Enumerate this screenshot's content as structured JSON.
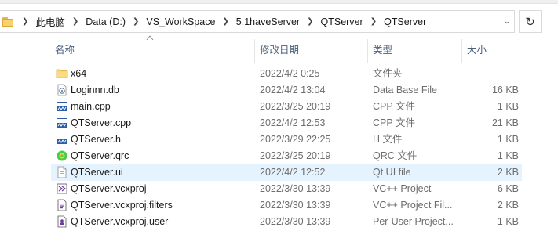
{
  "breadcrumb": [
    "此电脑",
    "Data (D:)",
    "VS_WorkSpace",
    "5.1haveServer",
    "QTServer",
    "QTServer"
  ],
  "columns": {
    "name": "名称",
    "date": "修改日期",
    "type": "类型",
    "size": "大小"
  },
  "files": [
    {
      "name": "x64",
      "date": "2022/4/2 0:25",
      "type": "文件夹",
      "size": "",
      "icon": "folder-icon"
    },
    {
      "name": "Loginnn.db",
      "date": "2022/4/2 13:04",
      "type": "Data Base File",
      "size": "16 KB",
      "icon": "database-file-icon"
    },
    {
      "name": "main.cpp",
      "date": "2022/3/25 20:19",
      "type": "CPP 文件",
      "size": "1 KB",
      "icon": "cpp-file-icon"
    },
    {
      "name": "QTServer.cpp",
      "date": "2022/4/2 12:53",
      "type": "CPP 文件",
      "size": "21 KB",
      "icon": "cpp-file-icon"
    },
    {
      "name": "QTServer.h",
      "date": "2022/3/29 22:25",
      "type": "H 文件",
      "size": "1 KB",
      "icon": "header-file-icon"
    },
    {
      "name": "QTServer.qrc",
      "date": "2022/3/25 20:19",
      "type": "QRC 文件",
      "size": "1 KB",
      "icon": "qt-resource-icon"
    },
    {
      "name": "QTServer.ui",
      "date": "2022/4/2 12:52",
      "type": "Qt UI file",
      "size": "2 KB",
      "icon": "ui-file-icon"
    },
    {
      "name": "QTServer.vcxproj",
      "date": "2022/3/30 13:39",
      "type": "VC++ Project",
      "size": "6 KB",
      "icon": "vcxproj-icon"
    },
    {
      "name": "QTServer.vcxproj.filters",
      "date": "2022/3/30 13:39",
      "type": "VC++ Project Fil...",
      "size": "2 KB",
      "icon": "vcxproj-filters-icon"
    },
    {
      "name": "QTServer.vcxproj.user",
      "date": "2022/3/30 13:39",
      "type": "Per-User Project...",
      "size": "1 KB",
      "icon": "vcxproj-user-icon"
    }
  ],
  "hovered_row": 6
}
